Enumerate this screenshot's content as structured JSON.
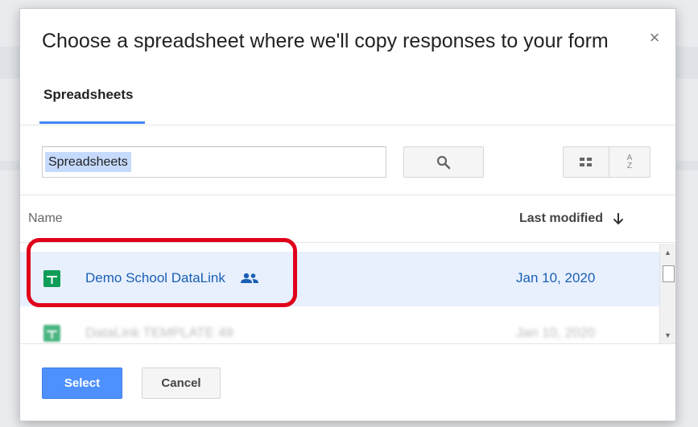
{
  "dialog": {
    "title": "Choose a spreadsheet where we'll copy responses to your form",
    "close_label": "×"
  },
  "tabs": [
    {
      "label": "Spreadsheets",
      "active": true
    }
  ],
  "search": {
    "value": "Spreadsheets",
    "button_icon": "search-icon"
  },
  "view_controls": {
    "grid_icon": "grid-view-icon",
    "sort_icon": "sort-az-icon",
    "sort_top": "A",
    "sort_bottom": "Z"
  },
  "list": {
    "columns": {
      "name": "Name",
      "modified": "Last modified",
      "sort_direction": "descending"
    },
    "rows": [
      {
        "name": "Demo School DataLink",
        "modified": "Jan 10, 2020",
        "shared": true,
        "selected": true,
        "icon": "sheets-icon"
      },
      {
        "name": "DataLink TEMPLATE 49",
        "modified": "Jan 10, 2020",
        "shared": false,
        "selected": false,
        "icon": "sheets-icon"
      }
    ]
  },
  "buttons": {
    "select": "Select",
    "cancel": "Cancel"
  },
  "colors": {
    "accent_blue": "#4285f4",
    "select_button": "#4d90fe",
    "selected_row": "#e8f0fe",
    "link_text": "#1a5fb4",
    "sheets_green": "#0f9d58",
    "highlight_annotation": "#e0001a"
  }
}
